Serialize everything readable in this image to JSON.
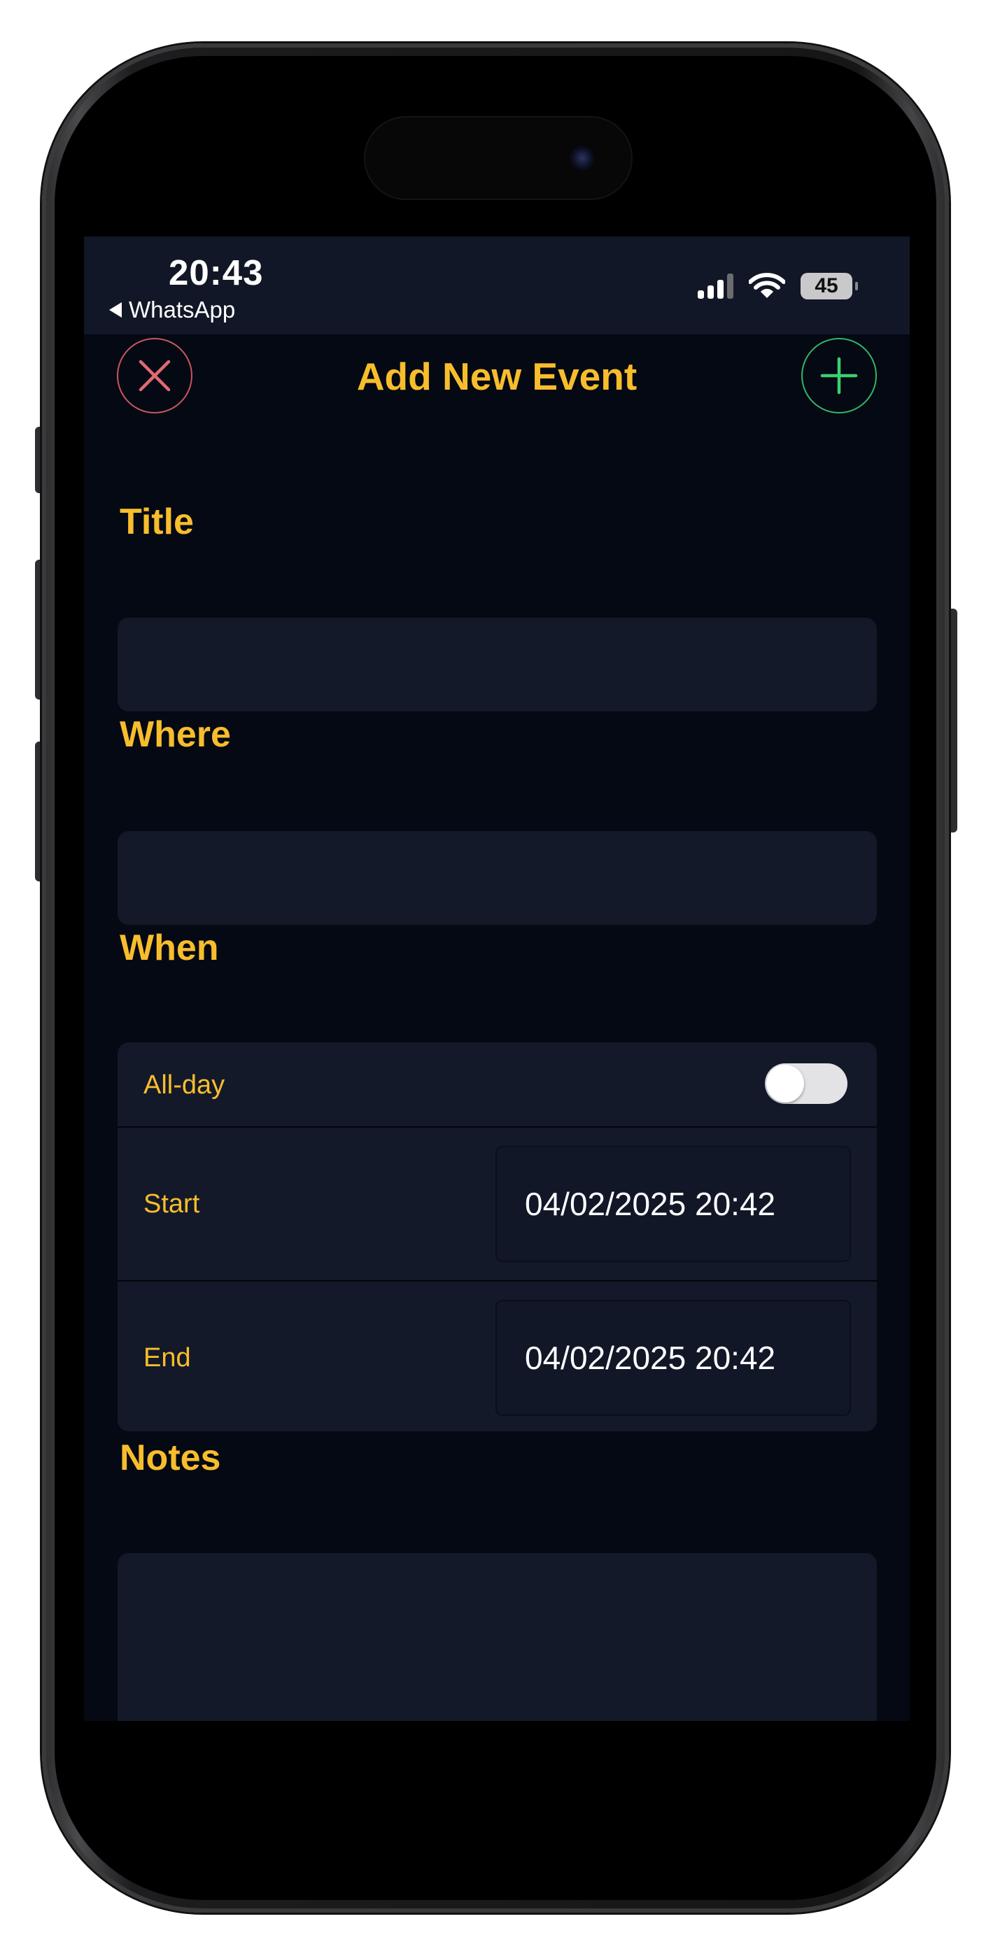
{
  "status_bar": {
    "time": "20:43",
    "back_app": "WhatsApp",
    "battery": "45",
    "icons": [
      "signal-icon",
      "wifi-icon",
      "battery-icon"
    ]
  },
  "header": {
    "title": "Add New Event",
    "close_icon": "close-icon",
    "add_icon": "plus-icon"
  },
  "form": {
    "title_label": "Title",
    "title_value": "",
    "where_label": "Where",
    "where_value": "",
    "when_label": "When",
    "all_day_label": "All-day",
    "all_day_on": false,
    "start_label": "Start",
    "start_value": "04/02/2025 20:42",
    "end_label": "End",
    "end_value": "04/02/2025 20:42",
    "notes_label": "Notes",
    "notes_value": ""
  },
  "colors": {
    "accent": "#f8bd2c",
    "background": "#050913",
    "field": "#131929",
    "close": "#c8575f",
    "add": "#33b567"
  }
}
